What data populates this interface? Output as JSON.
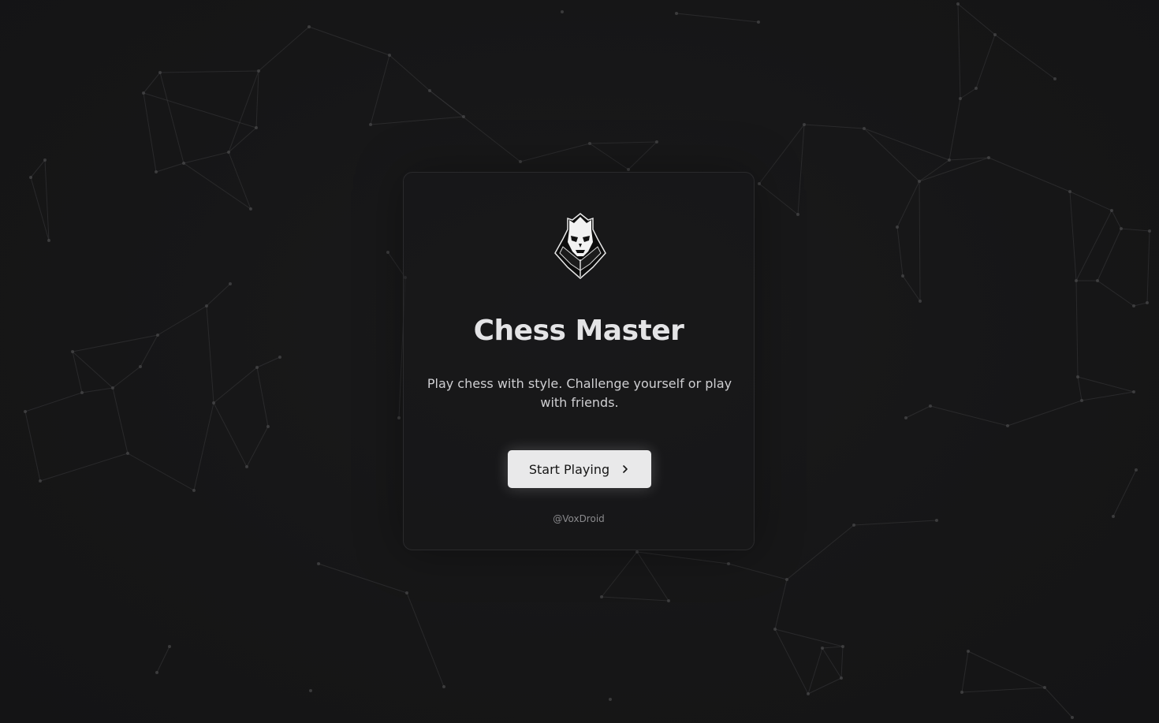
{
  "app": {
    "title": "Chess Master",
    "tagline": "Play chess with style. Challenge yourself or play with friends.",
    "cta_label": "Start Playing",
    "credit": "@VoxDroid"
  },
  "icons": {
    "logo": "chess-king-knight-emblem-icon",
    "cta_arrow": "chevron-right-icon"
  },
  "colors": {
    "background": "#161617",
    "card_border": "#2a2a2c",
    "title": "#e4e4e6",
    "button_bg": "#e9e9ea",
    "button_text": "#151515",
    "network_line": "#3a3a3c"
  }
}
